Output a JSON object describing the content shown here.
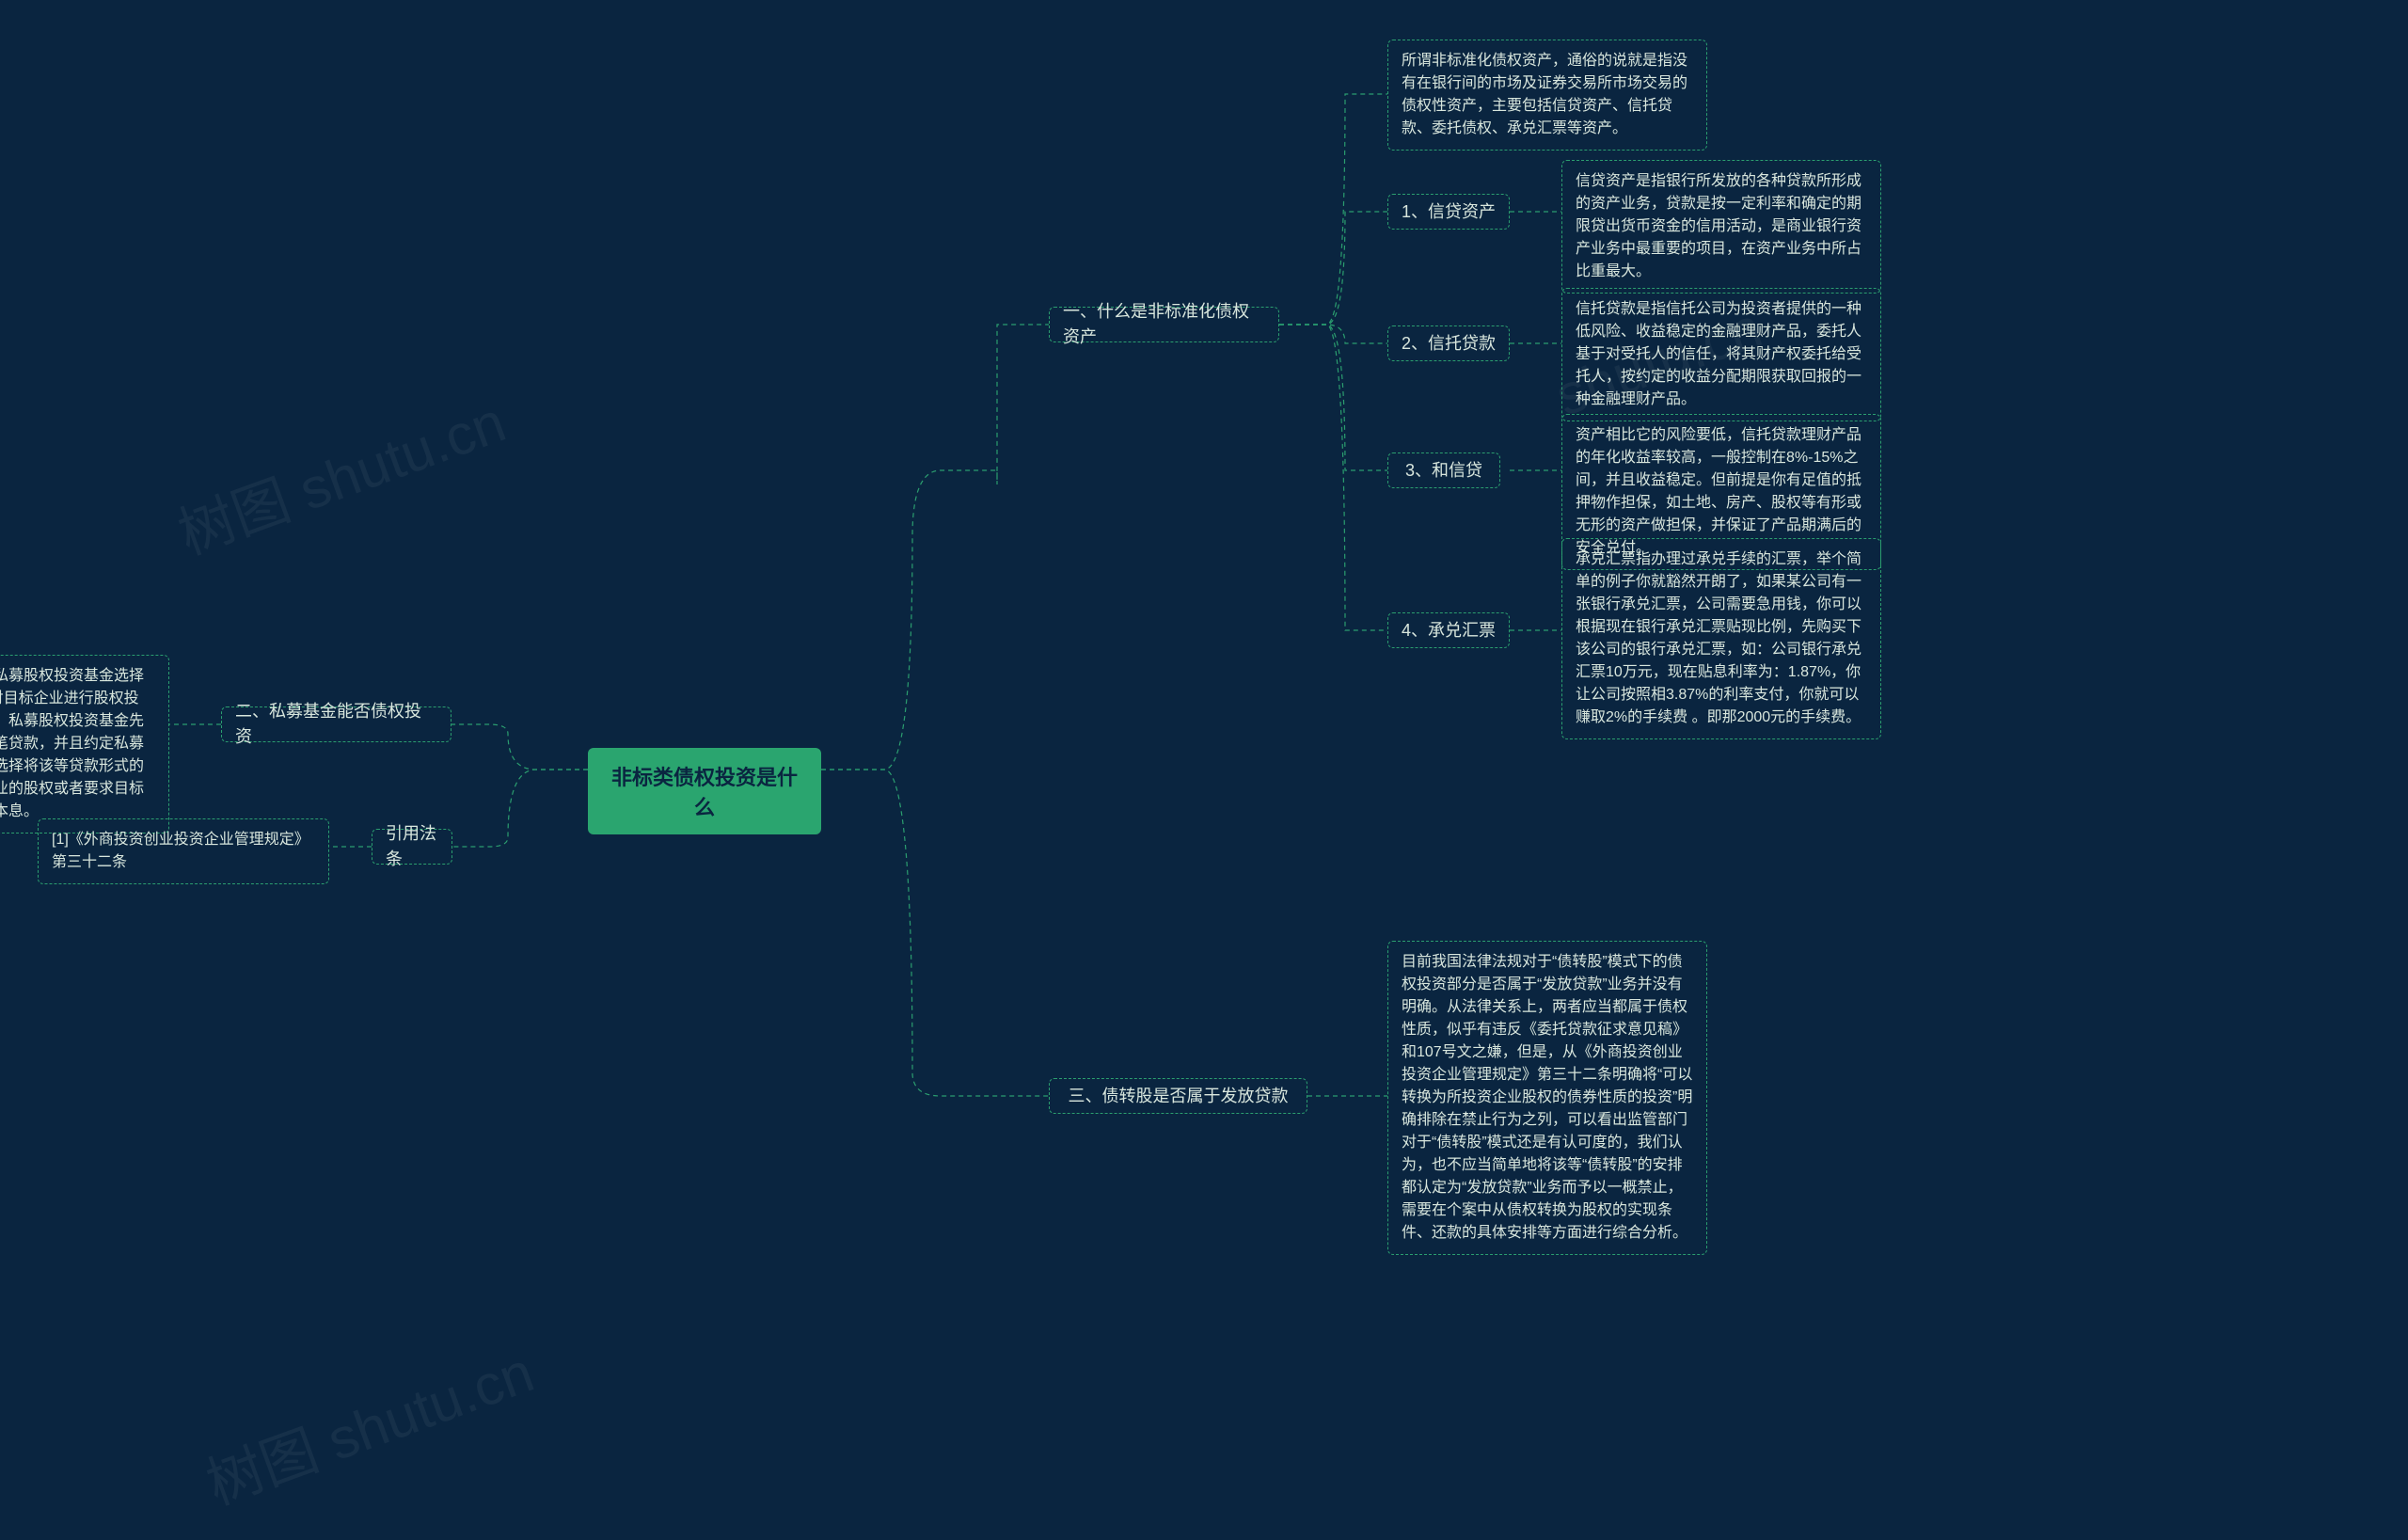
{
  "chart_data": {
    "type": "table",
    "title": "非标类债权投资是什么"
  },
  "watermarks": [
    "树图 shutu.cn",
    "shutu.cn",
    "树图 shutu.cn"
  ],
  "center": {
    "title": "非标类债权投资是什么"
  },
  "right": {
    "b1": {
      "label": "一、什么是非标准化债权资产",
      "intro": "所谓非标准化债权资产，通俗的说就是指没有在银行间的市场及证券交易所市场交易的债权性资产，主要包括信贷资产、信托贷款、委托债权、承兑汇票等资产。",
      "c1": {
        "label": "1、信贷资产",
        "text": "信贷资产是指银行所发放的各种贷款所形成的资产业务，贷款是按一定利率和确定的期限贷出货币资金的信用活动，是商业银行资产业务中最重要的项目，在资产业务中所占比重最大。"
      },
      "c2": {
        "label": "2、信托贷款",
        "text": "信托贷款是指信托公司为投资者提供的一种低风险、收益稳定的金融理财产品，委托人基于对受托人的信任，将其财产权委托给受托人，按约定的收益分配期限获取回报的一种金融理财产品。"
      },
      "c3": {
        "label": "3、和信贷",
        "text": "资产相比它的风险要低，信托贷款理财产品的年化收益率较高，一般控制在8%-15%之间，并且收益稳定。但前提是你有足值的抵押物作担保，如土地、房产、股权等有形或无形的资产做担保，并保证了产品期满后的安全兑付。"
      },
      "c4": {
        "label": "4、承兑汇票",
        "text": "承兑汇票指办理过承兑手续的汇票，举个简单的例子你就豁然开朗了，如果某公司有一张银行承兑汇票，公司需要急用钱，你可以根据现在银行承兑汇票贴现比例，先购买下该公司的银行承兑汇票，如：公司银行承兑汇票10万元，现在贴息利率为：1.87%，你让公司按照相3.87%的利率支付，你就可以赚取2%的手续费 。即那2000元的手续费。"
      }
    },
    "b3": {
      "label": "三、债转股是否属于发放贷款",
      "text": "目前我国法律法规对于“债转股”模式下的债权投资部分是否属于“发放贷款”业务并没有明确。从法律关系上，两者应当都属于债权性质，似乎有违反《委托贷款征求意见稿》和107号文之嫌，但是，从《外商投资创业投资企业管理规定》第三十二条明确将“可以转换为所投资企业股权的债券性质的投资”明确排除在禁止行为之列，可以看出监管部门对于“债转股”模式还是有认可度的，我们认为，也不应当简单地将该等“债转股”的安排都认定为“发放贷款”业务而予以一概禁止，需要在个案中从债权转换为股权的实现条件、还款的具体安排等方面进行综合分析。"
    }
  },
  "left": {
    "b2": {
      "label": "二、私募基金能否债权投资",
      "text": "实践中，也有不少私募股权投资基金选择以“债转股”的方式对目标企业进行股权投资，其安排主要为：私募股权投资基金先向目标企业提供一笔贷款，并且约定私募股权投资基金有权选择将该等贷款形式的债权转换为目标企业的股权或者要求目标企业到期归还借款本息。"
    },
    "b4": {
      "label": "引用法条",
      "text": "[1]《外商投资创业投资企业管理规定》第三十二条"
    }
  }
}
